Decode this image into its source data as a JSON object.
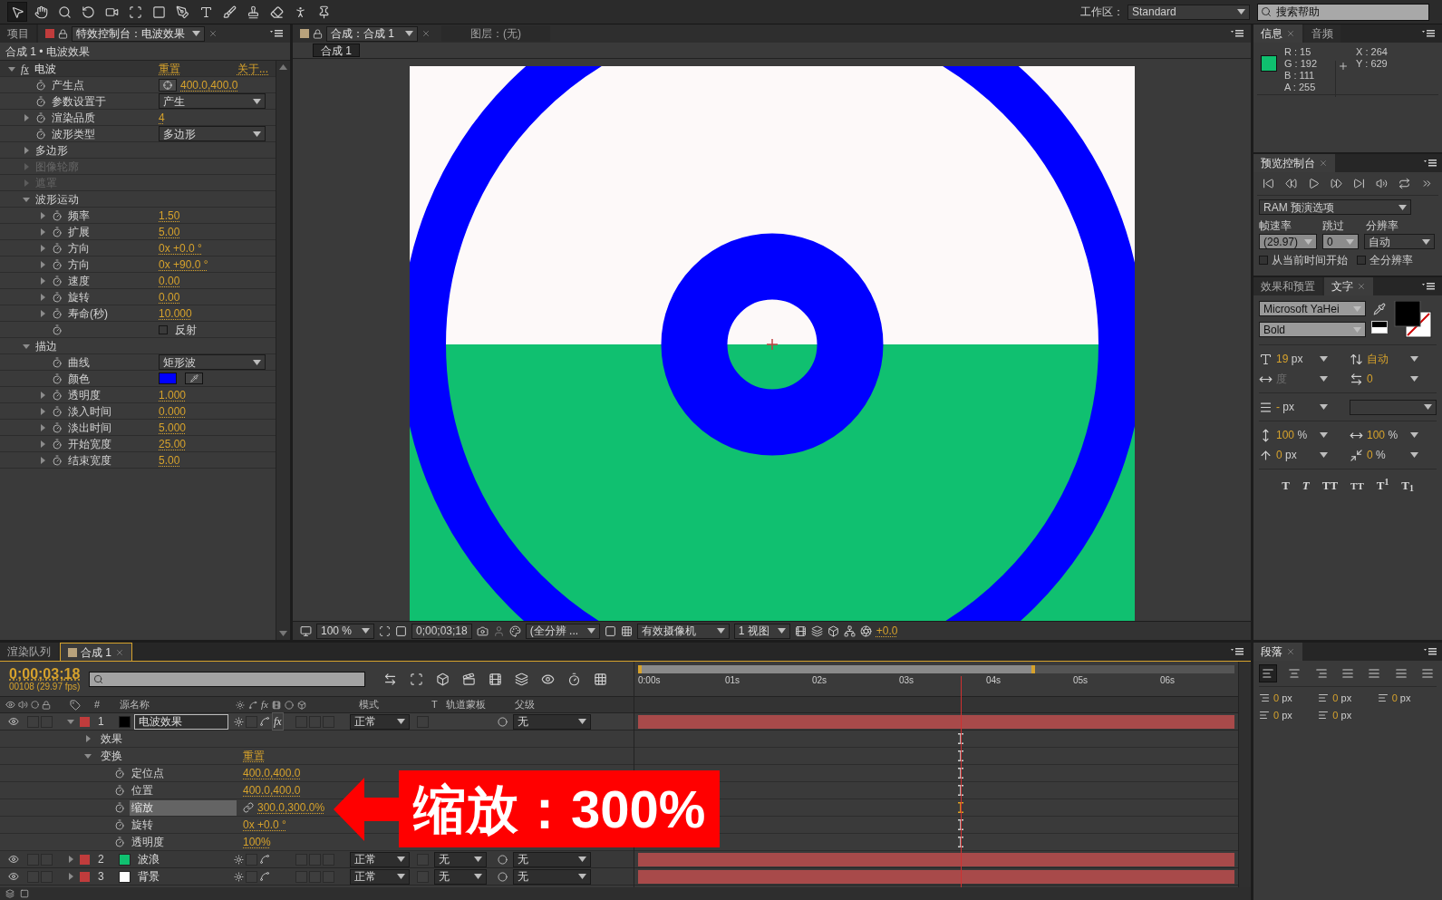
{
  "toolbar": {
    "tools": [
      {
        "kind": "select",
        "selected": true
      },
      {
        "kind": "hand",
        "selected": false
      },
      {
        "kind": "zoom",
        "selected": false
      },
      {
        "kind": "rotate",
        "selected": false
      },
      {
        "kind": "camera",
        "selected": false
      },
      {
        "kind": "pan-behind",
        "selected": false
      },
      {
        "kind": "rectangle",
        "selected": false
      },
      {
        "kind": "pen",
        "selected": false
      },
      {
        "kind": "text",
        "selected": false
      },
      {
        "kind": "brush",
        "selected": false
      },
      {
        "kind": "stamp",
        "selected": false
      },
      {
        "kind": "eraser",
        "selected": false
      },
      {
        "kind": "roto",
        "selected": false
      },
      {
        "kind": "puppet",
        "selected": false
      }
    ],
    "workspace_label": "工作区：",
    "workspace": "Standard",
    "help_search": {
      "placeholder": "搜索帮助"
    }
  },
  "effect_panel": {
    "tabs": [
      {
        "label": "项目",
        "selected": false
      },
      {
        "label": "特效控制台：电波效果",
        "selected": true
      }
    ],
    "breadcrumb": "合成 1 • 电波效果",
    "effect": {
      "badge": "fx",
      "name": "电波",
      "reset": "重置",
      "about": "关于...",
      "expanded": true
    },
    "rows": [
      {
        "kind": "point",
        "label": "产生点",
        "value": "400.0,400.0"
      },
      {
        "kind": "dropdown",
        "label": "参数设置于",
        "value": "产生"
      },
      {
        "kind": "value",
        "label": "渲染品质",
        "value": "4",
        "expanded": false
      },
      {
        "kind": "dropdown",
        "label": "波形类型",
        "value": "多边形"
      },
      {
        "kind": "group",
        "label": "多边形",
        "expanded": false,
        "disabled": false
      },
      {
        "kind": "group",
        "label": "图像轮廓",
        "expanded": false,
        "disabled": true
      },
      {
        "kind": "group",
        "label": "遮罩",
        "expanded": false,
        "disabled": true
      },
      {
        "kind": "group",
        "label": "波形运动",
        "expanded": true,
        "disabled": false,
        "children": [
          {
            "kind": "value",
            "label": "频率",
            "value": "1.50",
            "expanded": false
          },
          {
            "kind": "value",
            "label": "扩展",
            "value": "5.00",
            "expanded": false
          },
          {
            "kind": "value",
            "label": "方向",
            "value": "0x +0.0 °",
            "expanded": false
          },
          {
            "kind": "value",
            "label": "方向",
            "value": "0x +90.0 °",
            "expanded": false
          },
          {
            "kind": "value",
            "label": "速度",
            "value": "0.00",
            "expanded": false
          },
          {
            "kind": "value",
            "label": "旋转",
            "value": "0.00",
            "expanded": false
          },
          {
            "kind": "value",
            "label": "寿命(秒)",
            "value": "10.000",
            "expanded": false
          },
          {
            "kind": "checkbox",
            "text": "反射",
            "checked": false
          }
        ]
      },
      {
        "kind": "group",
        "label": "描边",
        "expanded": true,
        "disabled": false,
        "children": [
          {
            "kind": "dropdown",
            "label": "曲线",
            "value": "矩形波"
          },
          {
            "kind": "color",
            "label": "颜色",
            "color": "#0000ff"
          },
          {
            "kind": "value",
            "label": "透明度",
            "value": "1.000",
            "expanded": false
          },
          {
            "kind": "value",
            "label": "淡入时间",
            "value": "0.000",
            "expanded": false
          },
          {
            "kind": "value",
            "label": "淡出时间",
            "value": "5.000",
            "expanded": false
          },
          {
            "kind": "value",
            "label": "开始宽度",
            "value": "25.00",
            "expanded": false
          },
          {
            "kind": "value",
            "label": "结束宽度",
            "value": "5.00",
            "expanded": false
          }
        ]
      }
    ]
  },
  "viewer": {
    "tabs": [
      {
        "label": "合成：合成 1",
        "selected": true
      },
      {
        "label": "图层：(无)",
        "selected": false
      }
    ],
    "subtab": "合成 1",
    "bottom_bar": {
      "zoom": "100 %",
      "timecode": "0;00;03;18",
      "resolution": "(全分辨 ...",
      "camera": "有效摄像机",
      "views": "1 视图",
      "exposure": "+0.0"
    }
  },
  "info_panel": {
    "tabs": [
      {
        "label": "信息",
        "selected": true
      },
      {
        "label": "音频",
        "selected": false
      }
    ],
    "color": "#0fc06f",
    "channels": [
      "R : 15",
      "G : 192",
      "B : 111",
      "A : 255"
    ],
    "coords": [
      "X : 264",
      "Y : 629"
    ]
  },
  "preview_panel": {
    "title": "预览控制台",
    "ram_preview": "RAM 预演选项",
    "frame_rate_label": "帧速率",
    "skip_label": "跳过",
    "resolution_label": "分辨率",
    "frame_rate": "(29.97)",
    "skip": "0",
    "resolution": "自动",
    "options": [
      {
        "label": "从当前时间开始",
        "checked": false
      },
      {
        "label": "全分辨率",
        "checked": false
      }
    ]
  },
  "character_panel": {
    "tabs": [
      {
        "label": "效果和预置",
        "selected": false
      },
      {
        "label": "文字",
        "selected": true
      }
    ],
    "font": "Microsoft YaHei",
    "style": "Bold",
    "metrics": [
      {
        "kind": "font-size",
        "value": "19",
        "unit": "px",
        "disabled": false
      },
      {
        "kind": "leading",
        "value": "自动",
        "disabled": false
      },
      {
        "kind": "kerning",
        "value": "度",
        "disabled": true
      },
      {
        "kind": "tracking",
        "value": "0",
        "disabled": false
      },
      {
        "kind": "stroke-width",
        "value": "-",
        "unit": "px",
        "disabled": false
      },
      {
        "kind": "vertical-scale",
        "value": "100",
        "unit": "%",
        "disabled": false
      },
      {
        "kind": "horizontal-scale",
        "value": "100",
        "unit": "%",
        "disabled": false
      },
      {
        "kind": "baseline-shift",
        "value": "0",
        "unit": "px",
        "disabled": false
      },
      {
        "kind": "tsume",
        "value": "0",
        "unit": "%",
        "disabled": false
      }
    ],
    "styles": [
      {
        "kind": "bold",
        "text": "T"
      },
      {
        "kind": "italic",
        "text": "T"
      },
      {
        "kind": "caps",
        "text": "TT"
      },
      {
        "kind": "small-caps",
        "text": "TT"
      },
      {
        "kind": "superscript",
        "text": "T$^{1}$"
      },
      {
        "kind": "subscript",
        "text": "T$_{1}$"
      }
    ]
  },
  "paragraph_panel": {
    "title": "段落",
    "alignments": [
      {
        "selected": true
      },
      {
        "selected": false
      },
      {
        "selected": false
      },
      {
        "selected": false
      },
      {
        "selected": false
      },
      {
        "selected": false
      },
      {
        "selected": false
      }
    ],
    "indents": [
      {
        "value": "0",
        "unit": "px"
      },
      {
        "value": "0",
        "unit": "px"
      },
      {
        "value": "0",
        "unit": "px"
      },
      {
        "value": "0",
        "unit": "px"
      },
      {
        "value": "0",
        "unit": "px"
      }
    ]
  },
  "timeline": {
    "tabs": [
      {
        "label": "渲染队列",
        "selected": false
      },
      {
        "label": "合成 1",
        "selected": true
      }
    ],
    "timecode": "0;00;03;18",
    "frame_info": "00108 (29.97 fps)",
    "columns": {
      "number": "#",
      "source_name": "源名称",
      "fx": "fx",
      "mode": "模式",
      "t": "T",
      "track_matte": "轨道蒙板",
      "parent": "父级"
    },
    "ruler": [
      "0:00s",
      "01s",
      "02s",
      "03s",
      "04s",
      "05s",
      "06s"
    ],
    "work_area": {
      "level": 0.665
    },
    "playhead": {
      "level": 0.54
    },
    "layers": [
      {
        "number": "1",
        "name": "电波效果",
        "color": "#000000",
        "fx": "fx",
        "effects_on": true,
        "mode": "正常",
        "parent": "无",
        "expanded": true,
        "selected": true,
        "children": [
          {
            "name": "效果",
            "expanded": false
          },
          {
            "name": "变换",
            "expanded": true,
            "reset": "重置",
            "properties": [
              {
                "name": "定位点",
                "value": "400.0,400.0",
                "linked": false,
                "selected": false
              },
              {
                "name": "位置",
                "value": "400.0,400.0",
                "linked": false,
                "selected": false
              },
              {
                "name": "缩放",
                "value": "300.0,300.0%",
                "linked": true,
                "selected": true
              },
              {
                "name": "旋转",
                "value": "0x +0.0 °",
                "linked": false,
                "selected": false
              },
              {
                "name": "透明度",
                "value": "100%",
                "linked": false,
                "selected": false
              }
            ]
          }
        ]
      },
      {
        "number": "2",
        "name": "波浪",
        "color": "#10c070",
        "mode": "正常",
        "track_matte": "无",
        "parent": "无",
        "expanded": false,
        "selected": false
      },
      {
        "number": "3",
        "name": "背景",
        "color": "#ffffff",
        "mode": "正常",
        "track_matte": "无",
        "parent": "无",
        "expanded": false,
        "selected": false
      }
    ]
  },
  "annotation": {
    "text": "缩放：300%"
  }
}
